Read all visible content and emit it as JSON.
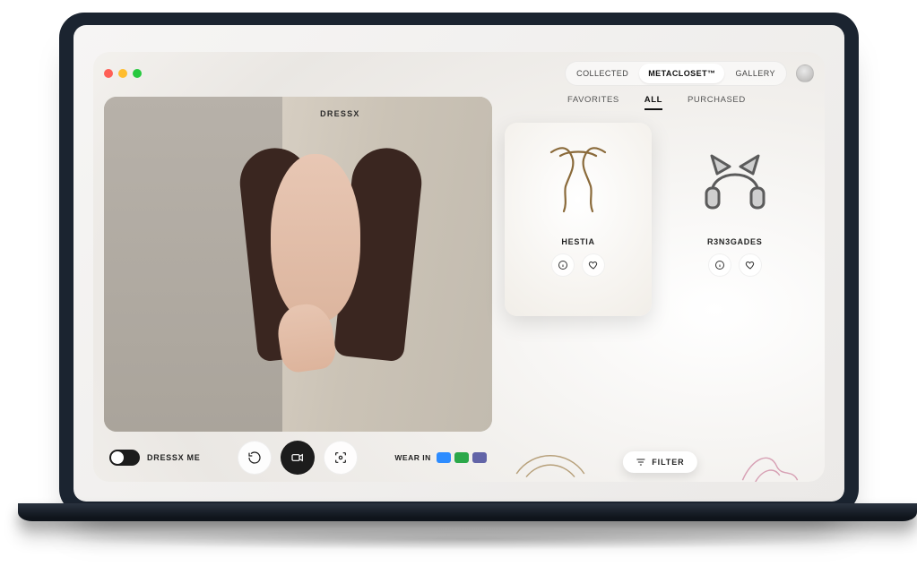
{
  "watermark": "DRESSX",
  "nav": {
    "items": [
      {
        "label": "COLLECTED"
      },
      {
        "label": "METACLOSET™"
      },
      {
        "label": "GALLERY"
      }
    ],
    "active_index": 1
  },
  "filters": {
    "items": [
      {
        "label": "FAVORITES"
      },
      {
        "label": "ALL"
      },
      {
        "label": "PURCHASED"
      }
    ],
    "active_index": 1
  },
  "controls": {
    "toggle_label": "DRESSX ME",
    "wear_in_label": "WEAR IN",
    "apps": [
      "zoom",
      "meet",
      "teams"
    ]
  },
  "cards": [
    {
      "name": "HESTIA",
      "icon_name": "liquid-hair-icon"
    },
    {
      "name": "R3N3GADES",
      "icon_name": "cat-ear-headphones-icon"
    }
  ],
  "filter_button": "FILTER"
}
